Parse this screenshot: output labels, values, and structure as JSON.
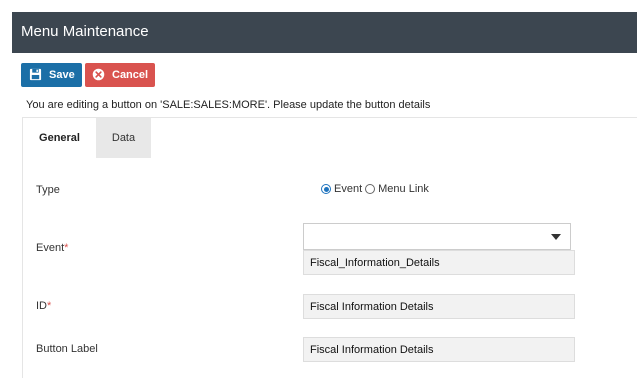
{
  "header": {
    "title": "Menu Maintenance"
  },
  "toolbar": {
    "save_label": "Save",
    "cancel_label": "Cancel"
  },
  "info": {
    "text": "You are editing a button on 'SALE:SALES:MORE'. Please update the button details"
  },
  "tabs": [
    {
      "label": "General",
      "active": true
    },
    {
      "label": "Data",
      "active": false
    }
  ],
  "form": {
    "type": {
      "label": "Type",
      "options": [
        {
          "label": "Event",
          "selected": true
        },
        {
          "label": "Menu Link",
          "selected": false
        }
      ]
    },
    "event": {
      "label": "Event",
      "required_mark": "*",
      "selected_value": "",
      "suggestion": "Fiscal_Information_Details"
    },
    "id": {
      "label": "ID",
      "required_mark": "*",
      "value": "Fiscal Information Details"
    },
    "button_label": {
      "label": "Button Label",
      "value": "Fiscal Information Details"
    }
  },
  "colors": {
    "header_bg": "#3c4650",
    "save_bg": "#1b6fa7",
    "cancel_bg": "#d9534f",
    "radio_accent": "#1e73be"
  }
}
